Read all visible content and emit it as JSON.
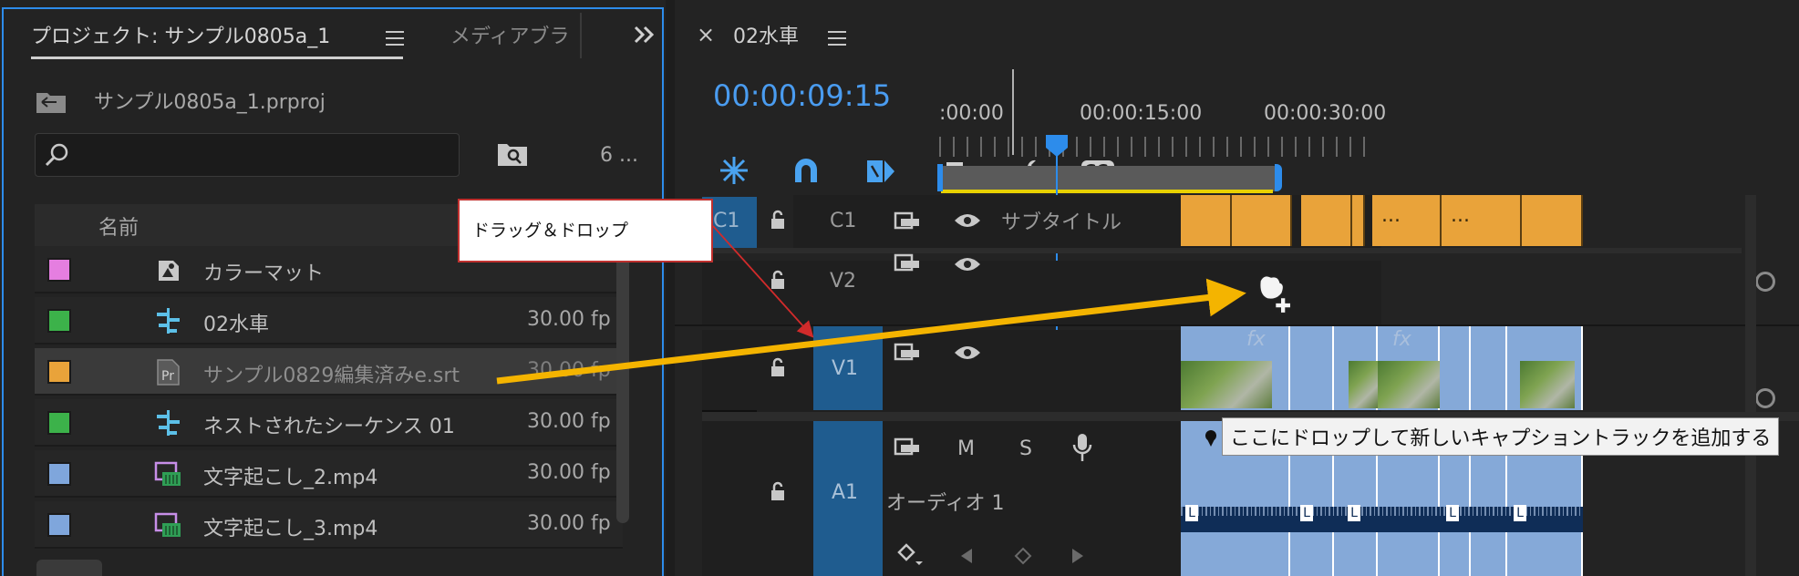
{
  "project_panel": {
    "tab_project": "プロジェクト:  サンプル0805a_1",
    "tab_media": "メディアブラ",
    "overflow_icon": "double-chevron-right-icon",
    "project_file": "サンプル0805a_1.prproj",
    "search_placeholder": "",
    "item_count": "6 ...",
    "column_name": "名前",
    "items": [
      {
        "name": "カラーマット",
        "fps": "",
        "color": "#e57ee0",
        "icon": "color-matte-icon"
      },
      {
        "name": "02水車",
        "fps": "30.00 fp",
        "color": "#3cb24a",
        "icon": "sequence-icon"
      },
      {
        "name": "サンプル0829編集済みe.srt",
        "fps": "30.00 fp",
        "color": "#e9a33a",
        "icon": "caption-file-icon"
      },
      {
        "name": "ネストされたシーケンス 01",
        "fps": "30.00 fp",
        "color": "#3cb24a",
        "icon": "sequence-icon"
      },
      {
        "name": "文字起こし_2.mp4",
        "fps": "30.00 fp",
        "color": "#7fa6dc",
        "icon": "video-clip-icon"
      },
      {
        "name": "文字起こし_3.mp4",
        "fps": "30.00 fp",
        "color": "#7fa6dc",
        "icon": "video-clip-icon"
      }
    ]
  },
  "timeline": {
    "close_glyph": "×",
    "sequence_name": "02水車",
    "timecode": "00:00:09:15",
    "ruler": [
      ":00:00",
      "00:00:15:00",
      "00:00:30:00"
    ],
    "cc_label": "CC",
    "tracks": {
      "c1_target": "C1",
      "c1": "C1",
      "c1_name": "サブタイトル",
      "v2": "V2",
      "v1": "V1",
      "a1": "A1",
      "a1_name": "オーディオ 1",
      "mute": "M",
      "solo": "S"
    },
    "caption_dots": [
      "...",
      "..."
    ],
    "fx_label": "fx",
    "audio_channel": "L",
    "drop_tooltip": "ここにドロップして新しいキャプショントラックを追加する"
  },
  "annotation": {
    "callout": "ドラッグ＆ドロップ",
    "arrow_color": "#f4b400",
    "callout_border": "#c0312f"
  }
}
